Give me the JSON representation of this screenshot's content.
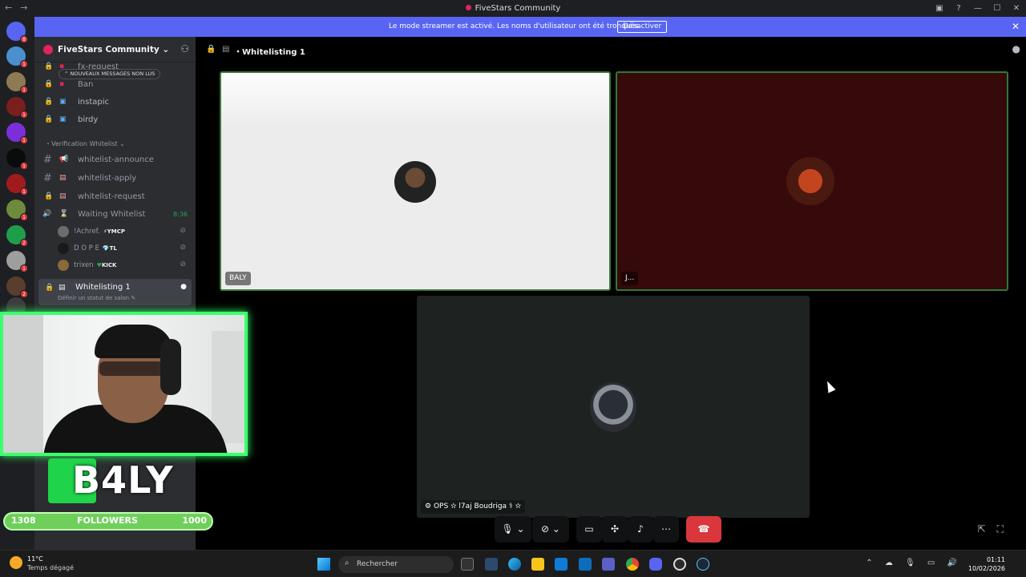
{
  "window": {
    "title": "FiveStars Community"
  },
  "banner": {
    "message": "Le mode streamer est activé. Les noms d'utilisateur ont été tronqués.",
    "button": "Désactiver"
  },
  "server": {
    "name": "FiveStars Community",
    "new_messages": "NOUVEAUX MESSAGES NON LUS"
  },
  "channels_top": [
    {
      "label": "fx-request"
    },
    {
      "label": "Ban"
    },
    {
      "label": "instapic"
    },
    {
      "label": "birdy"
    }
  ],
  "category": {
    "label": "Verification Whitelist"
  },
  "channels": [
    {
      "label": "whitelist-announce"
    },
    {
      "label": "whitelist-apply"
    },
    {
      "label": "whitelist-request"
    }
  ],
  "voice_channel": {
    "label": "Waiting Whitelist",
    "timer": "8:36",
    "users": [
      {
        "name": "!Achref.",
        "tag": "YMCP"
      },
      {
        "name": "D O P E",
        "tag": "TL"
      },
      {
        "name": "trixen",
        "tag": "KICK"
      }
    ]
  },
  "active_channel": {
    "label": "Whitelisting 1",
    "status": "Définir un statut de salon"
  },
  "header": {
    "title": "Whitelisting 1"
  },
  "tiles": [
    {
      "name": "BALY"
    },
    {
      "name": "J..."
    },
    {
      "name": "OPS ✫ l7aj Boudriga ⚕ ✫"
    }
  ],
  "overlay": {
    "brand": "B4LY",
    "followers_current": "1308",
    "followers_label": "FOLLOWERS",
    "followers_goal": "1000",
    "followers_fill": 1.0
  },
  "taskbar": {
    "temp": "11°C",
    "weather": "Temps dégagé",
    "search_placeholder": "Rechercher",
    "time": "01:11",
    "date": "10/02/2026"
  },
  "colors": {
    "blurple": "#5865f2",
    "hangup": "#da373c",
    "cam_border": "#3cff6e",
    "speaking": "#2f7a3a"
  }
}
